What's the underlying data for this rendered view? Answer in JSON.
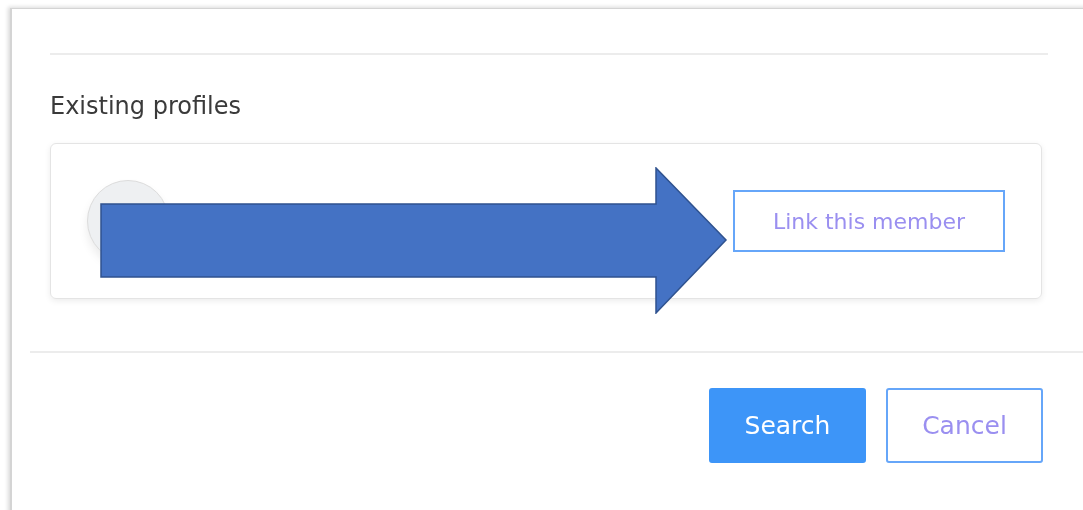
{
  "heading": "Existing profiles",
  "profiles": [
    {
      "action": "Link this member"
    }
  ],
  "buttons": [
    {
      "label": "Search",
      "kind": "primary"
    },
    {
      "label": "Cancel",
      "kind": "secondary"
    }
  ]
}
